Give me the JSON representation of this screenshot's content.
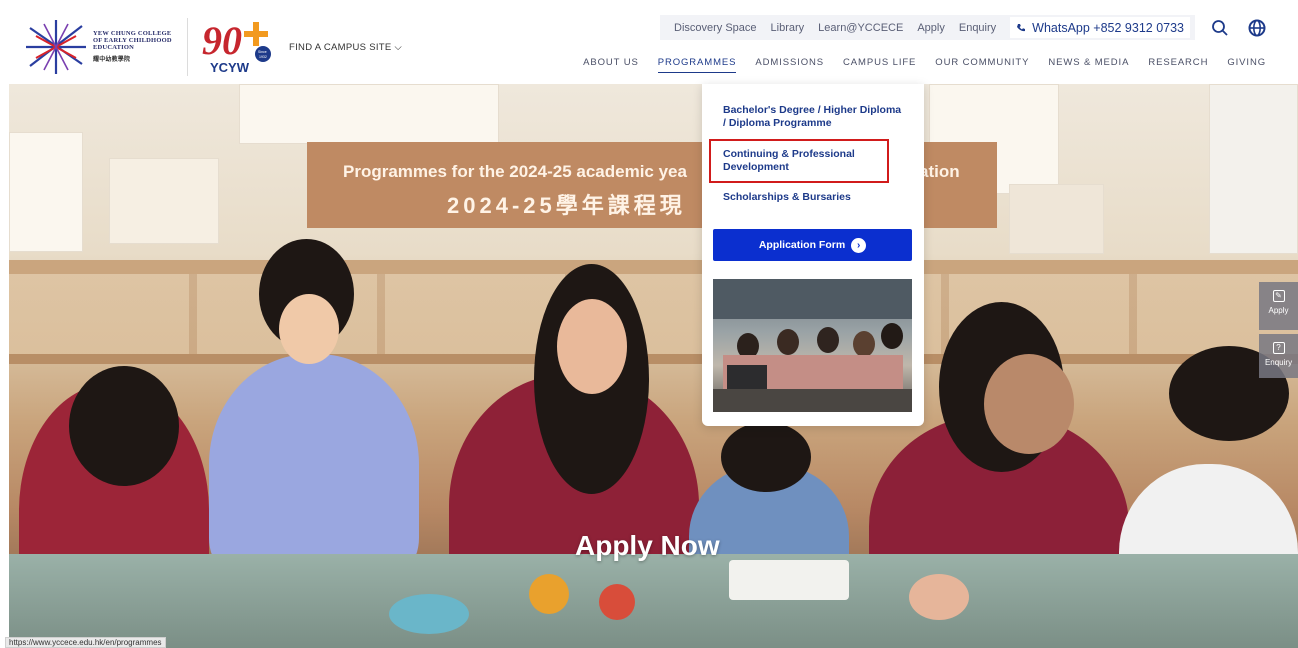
{
  "header": {
    "logo_text_line1": "YEW CHUNG COLLEGE",
    "logo_text_line2": "OF EARLY CHILDHOOD",
    "logo_text_line3": "EDUCATION",
    "logo_text_cn": "耀中幼教學院",
    "anniversary_brand": "YCYW",
    "anniversary_since": "Since 1932",
    "campus_link": "FIND A CAMPUS SITE",
    "utility_links": [
      "Discovery Space",
      "Library",
      "Learn@YCCECE",
      "Apply",
      "Enquiry"
    ],
    "whatsapp": "WhatsApp +852 9312 0733",
    "main_nav": [
      "ABOUT US",
      "PROGRAMMES",
      "ADMISSIONS",
      "CAMPUS LIFE",
      "OUR COMMUNITY",
      "NEWS & MEDIA",
      "RESEARCH",
      "GIVING"
    ],
    "active_nav": "PROGRAMMES"
  },
  "hero": {
    "banner_line1": "Programmes for the 2024-25 academic yea",
    "banner_line1_tail": "ation",
    "banner_line2": "2024-25學年課程現",
    "apply_now": "Apply Now"
  },
  "dropdown": {
    "items": [
      "Bachelor's Degree / Higher Diploma / Diploma Programme",
      "Continuing & Professional Development",
      "Scholarships & Bursaries"
    ],
    "application_button": "Application Form"
  },
  "side_tabs": {
    "apply": "Apply",
    "enquiry": "Enquiry"
  },
  "status_bar_url": "https://www.yccece.edu.hk/en/programmes",
  "colors": {
    "brand_blue": "#1d3a8a",
    "cta_blue": "#0b2fcf",
    "highlight_red": "#d11b1b",
    "banner_brown": "#bf8a63"
  }
}
